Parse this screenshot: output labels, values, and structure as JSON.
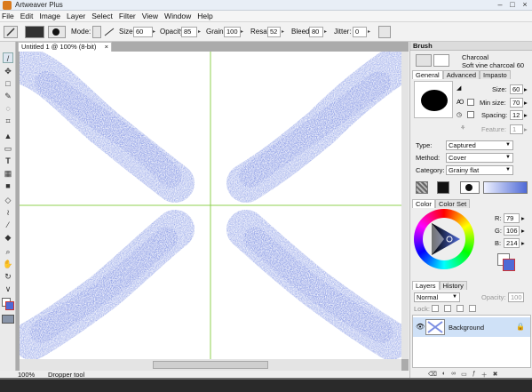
{
  "app": {
    "title": "Artweaver Plus"
  },
  "menu": [
    "File",
    "Edit",
    "Image",
    "Layer",
    "Select",
    "Filter",
    "View",
    "Window",
    "Help"
  ],
  "options": {
    "mode_label": "Mode:",
    "size_label": "Size:",
    "size": "60",
    "opacity_label": "Opacity:",
    "opacity": "85",
    "grain_label": "Grain:",
    "grain": "100",
    "resat_label": "Resat:",
    "resat": "52",
    "bleed_label": "Bleed:",
    "bleed": "80",
    "jitter_label": "Jitter:",
    "jitter": "0"
  },
  "document": {
    "tab": "Untitled 1 @ 100% (8-bit)",
    "close": "×"
  },
  "status": {
    "zoom": "100%",
    "message": "Dropper tool"
  },
  "brush": {
    "header": "Brush",
    "category": "Charcoal",
    "variant": "Soft vine charcoal 60",
    "tabs": [
      "General",
      "Advanced",
      "Impasto"
    ],
    "size_label": "Size:",
    "size": "60",
    "min_size_label": "Min size:",
    "min_size": "70",
    "spacing_label": "Spacing:",
    "spacing": "12",
    "feature_label": "Feature:",
    "feature": "1",
    "type_label": "Type:",
    "type": "Captured",
    "method_label": "Method:",
    "method": "Cover",
    "category_label": "Category:",
    "category_value": "Grainy flat"
  },
  "color": {
    "tabs": [
      "Color",
      "Color Set"
    ],
    "r_label": "R:",
    "r": "79",
    "g_label": "G:",
    "g": "106",
    "b_label": "B:",
    "b": "214",
    "foreground": "#4f6ad6"
  },
  "layers": {
    "tabs": [
      "Layers",
      "History"
    ],
    "blend": "Normal",
    "opacity_label": "Opacity:",
    "opacity": "100",
    "lock_label": "Lock:",
    "items": [
      {
        "name": "Background"
      }
    ]
  }
}
